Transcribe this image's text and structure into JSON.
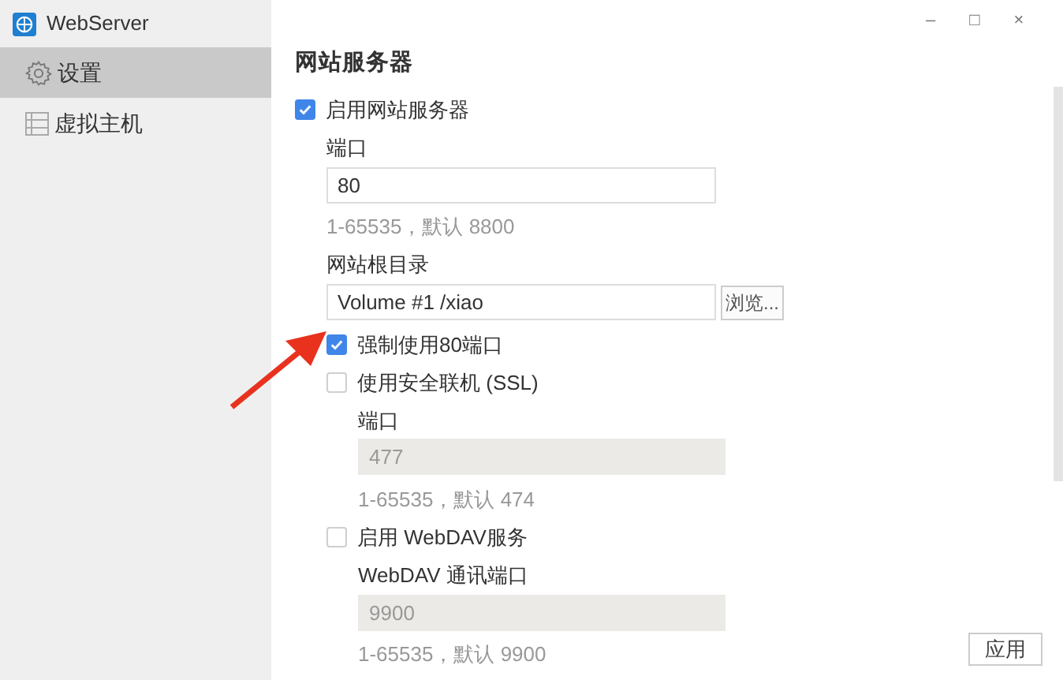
{
  "window": {
    "title": "WebServer",
    "controls": [
      "–",
      "□",
      "×"
    ]
  },
  "sidebar": {
    "items": [
      {
        "label": "设置",
        "kind": "gear",
        "selected": true
      },
      {
        "label": "虚拟主机",
        "kind": "list",
        "selected": false
      }
    ]
  },
  "section": {
    "title": "网站服务器",
    "items": [
      {
        "kind": "checkbox",
        "label": "启用网站服务器",
        "checked": true,
        "children": [
          {
            "kind": "label",
            "text": "端口"
          },
          {
            "kind": "input",
            "value": "80",
            "disabled": false
          },
          {
            "kind": "hint",
            "text": "1-65535，默认 8800"
          },
          {
            "kind": "label",
            "text": "网站根目录"
          },
          {
            "kind": "path",
            "value": "Volume #1 /xiao",
            "button": "浏览..."
          },
          {
            "kind": "checkbox",
            "label": "强制使用80端口",
            "checked": true
          },
          {
            "kind": "checkbox",
            "label": "使用安全联机 (SSL)",
            "checked": false,
            "children": [
              {
                "kind": "label",
                "text": "端口"
              },
              {
                "kind": "input",
                "value": "477",
                "disabled": true
              },
              {
                "kind": "hint",
                "text": "1-65535，默认 474"
              }
            ]
          },
          {
            "kind": "checkbox",
            "label": "启用 WebDAV服务",
            "checked": false,
            "children": [
              {
                "kind": "label",
                "text": "WebDAV 通讯端口"
              },
              {
                "kind": "input",
                "value": "9900",
                "disabled": true
              },
              {
                "kind": "hint",
                "text": "1-65535，默认 9900"
              }
            ]
          }
        ]
      }
    ]
  },
  "buttons": [
    "应用"
  ]
}
